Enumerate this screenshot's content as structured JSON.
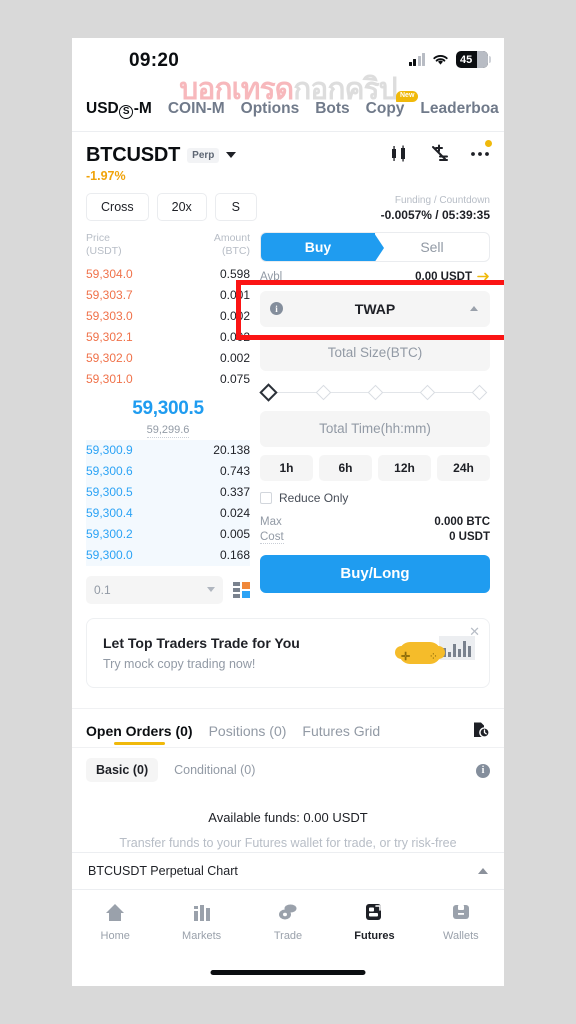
{
  "status_bar": {
    "time": "09:20",
    "battery_level": "45",
    "signal_icon": "cellular-signal-icon",
    "wifi_icon": "wifi-icon"
  },
  "watermark": {
    "text_primary": "บอกเทรด",
    "text_secondary": "กอกคริป"
  },
  "top_tabs": [
    {
      "label": "USD",
      "suffix": "-M",
      "circle": "S",
      "active": true,
      "name": "tab-usds-m"
    },
    {
      "label": "COIN-M",
      "active": false,
      "name": "tab-coin-m"
    },
    {
      "label": "Options",
      "active": false,
      "name": "tab-options"
    },
    {
      "label": "Bots",
      "active": false,
      "name": "tab-bots"
    },
    {
      "label": "Copy",
      "active": false,
      "badge": "New",
      "name": "tab-copy"
    },
    {
      "label": "Leaderboa",
      "active": false,
      "name": "tab-leaderboard"
    }
  ],
  "ticker": {
    "symbol": "BTCUSDT",
    "contract_type": "Perp",
    "change_percent": "-1.97%",
    "change_color": "#f0a30a",
    "icons": [
      "candlestick-chart-icon",
      "calculator-icon",
      "more-options-icon"
    ]
  },
  "chips": [
    {
      "label": "Cross",
      "name": "margin-mode-chip"
    },
    {
      "label": "20x",
      "name": "leverage-chip"
    },
    {
      "label": "S",
      "name": "position-mode-chip"
    }
  ],
  "funding": {
    "label": "Funding / Countdown",
    "value": "-0.0057% / 05:39:35"
  },
  "order_book": {
    "header_price": "Price",
    "header_price_unit": "(USDT)",
    "header_amount": "Amount",
    "header_amount_unit": "(BTC)",
    "asks": [
      {
        "price": "59,304.0",
        "amount": "0.598"
      },
      {
        "price": "59,303.7",
        "amount": "0.001"
      },
      {
        "price": "59,303.0",
        "amount": "0.002"
      },
      {
        "price": "59,302.1",
        "amount": "0.002"
      },
      {
        "price": "59,302.0",
        "amount": "0.002"
      },
      {
        "price": "59,301.0",
        "amount": "0.075"
      }
    ],
    "mid_price": "59,300.5",
    "mark_price": "59,299.6",
    "bids": [
      {
        "price": "59,300.9",
        "amount": "20.138"
      },
      {
        "price": "59,300.6",
        "amount": "0.743"
      },
      {
        "price": "59,300.5",
        "amount": "0.337"
      },
      {
        "price": "59,300.4",
        "amount": "0.024"
      },
      {
        "price": "59,300.2",
        "amount": "0.005"
      },
      {
        "price": "59,300.0",
        "amount": "0.168"
      }
    ],
    "grouping": "0.1",
    "depth_icon": "order-book-depth-icon",
    "ask_color": "#f0724a",
    "bid_color": "#2ca3f5",
    "mid_color": "#1f9cf0"
  },
  "order_form": {
    "buy_label": "Buy",
    "sell_label": "Sell",
    "avbl_label": "Avbl",
    "avbl_value": "0.00 USDT",
    "order_type": "TWAP",
    "order_type_info_icon": "info-icon",
    "order_type_caret": "chevron-up-icon",
    "total_size_placeholder": "Total Size(BTC)",
    "total_time_placeholder": "Total Time(hh:mm)",
    "time_presets": [
      "1h",
      "6h",
      "12h",
      "24h"
    ],
    "reduce_only_label": "Reduce Only",
    "max_label": "Max",
    "max_value": "0.000 BTC",
    "cost_label": "Cost",
    "cost_value": "0 USDT",
    "submit_label": "Buy/Long",
    "submit_color": "#1f9cf0"
  },
  "highlight": {
    "color": "#fb1414",
    "target": "order-type-selector"
  },
  "promo": {
    "title": "Let Top Traders Trade for You",
    "subtitle": "Try mock copy trading now!",
    "close_icon": "close-icon",
    "art_icon": "gamepad-chart-icon"
  },
  "orders": {
    "tabs": [
      {
        "label": "Open Orders (0)",
        "active": true,
        "name": "tab-open-orders"
      },
      {
        "label": "Positions (0)",
        "active": false,
        "name": "tab-positions"
      },
      {
        "label": "Futures Grid",
        "active": false,
        "name": "tab-futures-grid"
      }
    ],
    "history_icon": "order-history-icon",
    "sub_tabs": [
      {
        "label": "Basic (0)",
        "active": true,
        "name": "subtab-basic"
      },
      {
        "label": "Conditional (0)",
        "active": false,
        "name": "subtab-conditional"
      }
    ],
    "info_icon": "info-icon",
    "empty_title": "Available funds: 0.00 USDT",
    "empty_subtitle": "Transfer funds to your Futures wallet for trade, or try risk-free mock trading."
  },
  "chart_bar": {
    "label": "BTCUSDT Perpetual  Chart",
    "caret": "chevron-up-icon"
  },
  "bottom_nav": [
    {
      "label": "Home",
      "icon": "home-icon",
      "active": false,
      "name": "nav-home"
    },
    {
      "label": "Markets",
      "icon": "markets-bars-icon",
      "active": false,
      "name": "nav-markets"
    },
    {
      "label": "Trade",
      "icon": "trade-coins-icon",
      "active": false,
      "name": "nav-trade"
    },
    {
      "label": "Futures",
      "icon": "futures-icon",
      "active": true,
      "name": "nav-futures"
    },
    {
      "label": "Wallets",
      "icon": "wallet-icon",
      "active": false,
      "name": "nav-wallets"
    }
  ]
}
